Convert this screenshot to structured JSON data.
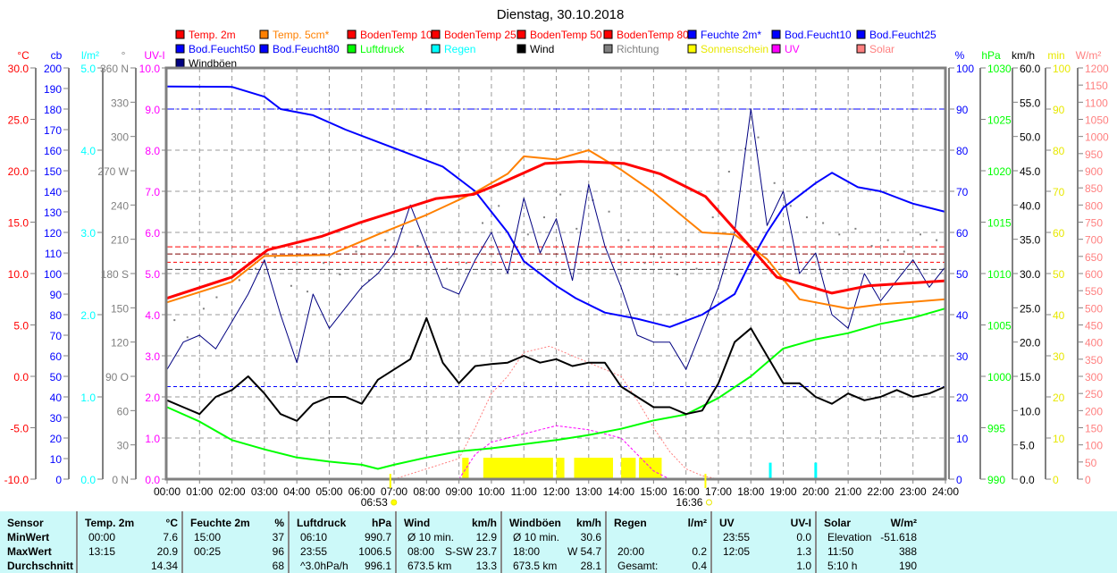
{
  "title": "Dienstag, 30.10.2018",
  "legend": [
    {
      "label": "Temp. 2m",
      "color": "#ff0000"
    },
    {
      "label": "Temp. 5cm*",
      "color": "#ff8000"
    },
    {
      "label": "BodenTemp 10",
      "color": "#ff0000"
    },
    {
      "label": "BodenTemp 25",
      "color": "#ff0000"
    },
    {
      "label": "BodenTemp 50",
      "color": "#ff0000"
    },
    {
      "label": "BodenTemp 80",
      "color": "#ff0000"
    },
    {
      "label": "Feuchte 2m*",
      "color": "#0000ff"
    },
    {
      "label": "Bod.Feucht10",
      "color": "#0000ff"
    },
    {
      "label": "Bod.Feucht25",
      "color": "#0000ff"
    },
    {
      "label": "Bod.Feucht50",
      "color": "#0000ff"
    },
    {
      "label": "Bod.Feucht80",
      "color": "#0000ff"
    },
    {
      "label": "Luftdruck",
      "color": "#00ff00"
    },
    {
      "label": "Regen",
      "color": "#00ffff"
    },
    {
      "label": "Wind",
      "color": "#000000"
    },
    {
      "label": "Richtung",
      "color": "#808080"
    },
    {
      "label": "Sonnenschein",
      "color": "#ffff00"
    },
    {
      "label": "UV",
      "color": "#ff00ff"
    },
    {
      "label": "Solar",
      "color": "#ff8080"
    },
    {
      "label": "Windböen",
      "color": "#000080"
    }
  ],
  "chart_data": {
    "type": "line",
    "title": "Dienstag, 30.10.2018",
    "x_labels": [
      "00:00",
      "01:00",
      "02:00",
      "03:00",
      "04:00",
      "05:00",
      "06:00",
      "07:00",
      "08:00",
      "09:00",
      "10:00",
      "11:00",
      "12:00",
      "13:00",
      "14:00",
      "15:00",
      "16:00",
      "17:00",
      "18:00",
      "19:00",
      "20:00",
      "21:00",
      "22:00",
      "23:00",
      "24:00"
    ],
    "xlim": [
      0,
      24
    ],
    "sunrise": "06:53",
    "sunset": "16:36",
    "sunrise_h": 6.883,
    "sunset_h": 16.6,
    "axes": {
      "temp": {
        "unit": "°C",
        "color": "#ff0000",
        "min": -10,
        "max": 30,
        "labels": [
          "-10.0",
          "-5.0",
          "0.0",
          "5.0",
          "10.0",
          "15.0",
          "20.0",
          "25.0",
          "30.0"
        ]
      },
      "cb": {
        "unit": "cb",
        "color": "#0000ff",
        "min": 0,
        "max": 200,
        "labels": [
          "0",
          "10",
          "20",
          "30",
          "40",
          "50",
          "60",
          "70",
          "80",
          "90",
          "100",
          "110",
          "120",
          "130",
          "140",
          "150",
          "160",
          "170",
          "180",
          "190",
          "200"
        ]
      },
      "rain": {
        "unit": "l/m²",
        "color": "#00ffff",
        "min": 0,
        "max": 5,
        "labels": [
          "0.0",
          "1.0",
          "2.0",
          "3.0",
          "4.0",
          "5.0"
        ]
      },
      "dir": {
        "unit": "°",
        "color": "#808080",
        "min": 0,
        "max": 360,
        "labels": [
          "0 N",
          "30",
          "60",
          "90 O",
          "120",
          "150",
          "180 S",
          "210",
          "240",
          "270 W",
          "300",
          "330",
          "360 N"
        ]
      },
      "uv": {
        "unit": "UV-I",
        "color": "#ff00ff",
        "min": 0,
        "max": 10,
        "labels": [
          "0.0",
          "1.0",
          "2.0",
          "3.0",
          "4.0",
          "5.0",
          "6.0",
          "7.0",
          "8.0",
          "9.0",
          "10.0"
        ]
      },
      "hum": {
        "unit": "%",
        "color": "#0000ff",
        "min": 0,
        "max": 100,
        "labels": [
          "0",
          "10",
          "20",
          "30",
          "40",
          "50",
          "60",
          "70",
          "80",
          "90",
          "100"
        ]
      },
      "press": {
        "unit": "hPa",
        "color": "#00ff00",
        "min": 990,
        "max": 1030,
        "labels": [
          "990",
          "995",
          "1000",
          "1005",
          "1010",
          "1015",
          "1020",
          "1025",
          "1030"
        ]
      },
      "wind": {
        "unit": "km/h",
        "color": "#000000",
        "min": 0,
        "max": 60,
        "labels": [
          "0.0",
          "5.0",
          "10.0",
          "15.0",
          "20.0",
          "25.0",
          "30.0",
          "35.0",
          "40.0",
          "45.0",
          "50.0",
          "55.0",
          "60.0"
        ]
      },
      "sun": {
        "unit": "min",
        "color": "#ffff00",
        "min": 0,
        "max": 100,
        "labels": [
          "0",
          "10",
          "20",
          "30",
          "40",
          "50",
          "60",
          "70",
          "80",
          "90",
          "100"
        ]
      },
      "solar": {
        "unit": "W/m²",
        "color": "#ff8080",
        "min": 0,
        "max": 1200,
        "labels": [
          "0",
          "50",
          "100",
          "150",
          "200",
          "250",
          "300",
          "350",
          "400",
          "450",
          "500",
          "550",
          "600",
          "650",
          "700",
          "750",
          "800",
          "850",
          "900",
          "950",
          "1000",
          "1050",
          "1100",
          "1150",
          "1200"
        ]
      }
    },
    "series": [
      {
        "name": "Solar",
        "axis": "solar",
        "color": "#ff8080",
        "dash": "2,2",
        "width": 1,
        "x": [
          7,
          8,
          9,
          9.5,
          10,
          10.5,
          11,
          11.8,
          12.5,
          13,
          14,
          14.5,
          15,
          15.5,
          16,
          16.5,
          17
        ],
        "y": [
          0,
          30,
          60,
          150,
          250,
          300,
          370,
          388,
          360,
          340,
          300,
          230,
          150,
          80,
          30,
          10,
          0
        ]
      },
      {
        "name": "UV",
        "axis": "uv",
        "color": "#ff00ff",
        "dash": "3,2",
        "width": 1,
        "x": [
          9,
          9.5,
          10,
          11,
          12,
          13,
          14,
          14.5,
          15,
          15.5
        ],
        "y": [
          0,
          0.6,
          0.9,
          1.1,
          1.3,
          1.2,
          1.0,
          0.6,
          0.2,
          0
        ]
      },
      {
        "name": "Luftdruck",
        "axis": "press",
        "color": "#00ff00",
        "width": 2,
        "x": [
          0,
          1,
          2,
          3,
          4,
          5,
          6,
          6.5,
          7,
          8,
          9,
          10,
          11,
          12,
          13,
          14,
          15,
          16,
          17,
          18,
          19,
          20,
          21,
          22,
          23,
          24
        ],
        "y": [
          997.0,
          995.6,
          993.8,
          992.9,
          992.1,
          991.7,
          991.4,
          991.0,
          991.4,
          992.1,
          992.7,
          993,
          993.4,
          993.8,
          994.3,
          994.9,
          995.7,
          996.3,
          997.9,
          1000,
          1002.7,
          1003.6,
          1004.2,
          1005.1,
          1005.7,
          1006.6
        ]
      },
      {
        "name": "Feuchte 2m*",
        "axis": "hum",
        "color": "#0000ff",
        "width": 2,
        "x": [
          0,
          2,
          3,
          3.5,
          4.5,
          5.5,
          6.5,
          7.5,
          8.5,
          9.5,
          10.5,
          11,
          12,
          12.6,
          13.5,
          14.5,
          15,
          15.5,
          16.5,
          17.5,
          18,
          18.5,
          19,
          20,
          20.5,
          21.3,
          22,
          23,
          24
        ],
        "y": [
          95.5,
          95.4,
          93,
          90,
          88.5,
          85,
          82,
          79,
          76,
          70,
          60,
          53,
          47,
          44,
          40.5,
          39,
          38,
          37,
          40,
          45,
          53,
          60,
          66,
          72,
          74.5,
          71,
          70,
          67,
          65
        ]
      },
      {
        "name": "Windböen",
        "axis": "wind",
        "color": "#000080",
        "width": 1,
        "x": [
          0,
          0.5,
          1,
          1.5,
          2,
          2.5,
          3,
          3.5,
          4,
          4.5,
          5,
          5.5,
          6,
          6.5,
          7,
          7.5,
          8,
          8.5,
          9,
          9.5,
          10,
          10.5,
          11,
          11.5,
          12,
          12.5,
          13,
          13.5,
          14,
          14.5,
          15,
          15.5,
          16,
          16.5,
          17,
          17.5,
          18,
          18.5,
          19,
          19.5,
          20,
          20.5,
          21,
          21.5,
          22,
          22.5,
          23,
          23.5,
          24
        ],
        "y": [
          16,
          20,
          21,
          19,
          23,
          27,
          32,
          24,
          17,
          27,
          22,
          25,
          28,
          30,
          33,
          40,
          34,
          28,
          27,
          32,
          36,
          30,
          41,
          33,
          38,
          29,
          43,
          34,
          28,
          21,
          20,
          20,
          16,
          22,
          28,
          36,
          54,
          37,
          42,
          30,
          33,
          24,
          22,
          30,
          26,
          29,
          32,
          28,
          31
        ]
      },
      {
        "name": "Wind",
        "axis": "wind",
        "color": "#000000",
        "width": 2,
        "x": [
          0,
          0.5,
          1,
          1.5,
          2,
          2.5,
          3,
          3.5,
          4,
          4.5,
          5,
          5.5,
          6,
          6.5,
          7,
          7.5,
          8,
          8.5,
          9,
          9.5,
          10,
          10.5,
          11,
          11.5,
          12,
          12.5,
          13,
          13.5,
          14,
          14.5,
          15,
          15.5,
          16,
          16.5,
          17,
          17.5,
          18,
          18.5,
          19,
          19.5,
          20,
          20.5,
          21,
          21.5,
          22,
          22.5,
          23,
          23.5,
          24
        ],
        "y": [
          11.5,
          10.5,
          9.5,
          12,
          13,
          15,
          12.5,
          9.5,
          8.5,
          11,
          12,
          12,
          11,
          14.5,
          16,
          17.5,
          23.5,
          17,
          14,
          16.5,
          16.8,
          17,
          18,
          17,
          17.5,
          16.5,
          17,
          17,
          13.5,
          12,
          10.5,
          10.5,
          9.5,
          10,
          14,
          20,
          22,
          18,
          14,
          14,
          12,
          11,
          12.5,
          11.5,
          12,
          13,
          12,
          12.5,
          13.5
        ]
      },
      {
        "name": "Temp. 5cm*",
        "axis": "temp",
        "color": "#ff8000",
        "width": 2,
        "x": [
          0,
          2,
          3,
          5,
          6.5,
          8,
          9.5,
          10.5,
          11,
          12,
          13,
          14,
          15,
          16,
          16.5,
          17.5,
          18.5,
          19.5,
          21,
          22,
          24
        ],
        "y": [
          7.2,
          9.2,
          11.7,
          11.8,
          13.8,
          15.7,
          17.9,
          19.7,
          21.4,
          21.1,
          22.0,
          20.1,
          17.9,
          15.3,
          14.0,
          13.8,
          11.4,
          7.5,
          6.6,
          7.0,
          7.5
        ]
      },
      {
        "name": "Temp. 2m",
        "axis": "temp",
        "color": "#ff0000",
        "width": 3,
        "x": [
          0,
          2,
          3.1,
          4.75,
          5.9,
          7,
          8.3,
          9.45,
          10.3,
          11.65,
          12.75,
          14.1,
          15.2,
          16.6,
          17.7,
          18.8,
          20.5,
          21.6,
          24
        ],
        "y": [
          7.6,
          9.65,
          12.3,
          13.6,
          14.9,
          16.0,
          17.3,
          17.7,
          18.8,
          20.7,
          20.9,
          20.7,
          19.7,
          17.5,
          13.6,
          9.65,
          8.1,
          8.8,
          9.3
        ]
      }
    ],
    "constant_lines": [
      {
        "name": "Bod.Feucht10",
        "axis": "hum",
        "value": 90,
        "color": "#0000ff",
        "dash": "8,3,2,3"
      },
      {
        "name": "Bod.Feucht25",
        "axis": "hum",
        "value": 100,
        "color": "#0000ff",
        "dash": ""
      },
      {
        "name": "BodenTemp 10",
        "axis": "temp",
        "value": 12.6,
        "color": "#ff0000",
        "dash": "6,3"
      },
      {
        "name": "BodenTemp 25",
        "axis": "temp",
        "value": 11.9,
        "color": "#800000",
        "dash": "6,3"
      },
      {
        "name": "BodenTemp 50",
        "axis": "temp",
        "value": 11.1,
        "color": "#ff0000",
        "dash": "4,3"
      },
      {
        "name": "BodenTemp 80",
        "axis": "temp",
        "value": 10.4,
        "color": "#404040",
        "dash": "6,3"
      },
      {
        "name": "Bod.Feucht50",
        "axis": "hum",
        "value": 22.5,
        "color": "#0000ff",
        "dash": "4,3"
      }
    ],
    "richtung": {
      "axis": "dir",
      "color": "#808080",
      "x": [
        0.2,
        0.6,
        1.1,
        1.5,
        2.2,
        2.7,
        3.3,
        3.8,
        4.3,
        4.8,
        5.3,
        5.8,
        6.2,
        6.7,
        7.2,
        7.7,
        8.1,
        8.6,
        9.2,
        9.7,
        10.2,
        10.6,
        11.1,
        11.6,
        12.1,
        12.6,
        13.1,
        13.6,
        14.2,
        14.7,
        15.2,
        15.7,
        16.3,
        16.8,
        17.3,
        17.8,
        18.2,
        18.7,
        19.2,
        19.7,
        20.2,
        20.7,
        21.2,
        21.7,
        22.2,
        22.7,
        23.2,
        23.7
      ],
      "y": [
        140,
        125,
        150,
        160,
        175,
        185,
        195,
        170,
        165,
        190,
        180,
        200,
        175,
        210,
        220,
        205,
        195,
        185,
        190,
        225,
        240,
        200,
        215,
        230,
        250,
        220,
        245,
        235,
        210,
        190,
        195,
        180,
        185,
        230,
        270,
        290,
        300,
        260,
        240,
        230,
        225,
        215,
        220,
        205,
        210,
        200,
        215,
        210
      ]
    },
    "sunshine": {
      "axis": "sun",
      "color": "#ffff00",
      "bars": [
        [
          9.1,
          9.3,
          5.2
        ],
        [
          9.75,
          11.9,
          5.2
        ],
        [
          12.0,
          12.25,
          5.2
        ],
        [
          12.55,
          13.75,
          5.2
        ],
        [
          14.0,
          14.45,
          5.2
        ],
        [
          14.55,
          15.25,
          5.2
        ]
      ]
    },
    "rain": {
      "axis": "rain",
      "color": "#00ffff",
      "bars": [
        [
          18.6,
          0.2
        ],
        [
          20.0,
          0.2
        ]
      ]
    }
  },
  "table": {
    "row_labels": [
      "Sensor",
      "MinWert",
      "MaxWert",
      "Durchschnitt"
    ],
    "columns": [
      {
        "name": "Temp. 2m",
        "unit": "°C",
        "rows": [
          [
            "00:00",
            "7.6"
          ],
          [
            "13:15",
            "20.9"
          ],
          [
            "",
            "14.34"
          ]
        ]
      },
      {
        "name": "Feuchte 2m",
        "unit": "%",
        "rows": [
          [
            "15:00",
            "37"
          ],
          [
            "00:25",
            "96"
          ],
          [
            "",
            "68"
          ]
        ]
      },
      {
        "name": "Luftdruck",
        "unit": "hPa",
        "rows": [
          [
            "06:10",
            "990.7"
          ],
          [
            "23:55",
            "1006.5"
          ],
          [
            "^3.0hPa/h",
            "996.1"
          ]
        ]
      },
      {
        "name": "Wind",
        "unit": "km/h",
        "rows": [
          [
            "Ø 10 min.",
            "12.9"
          ],
          [
            "08:00",
            "S-SW 23.7"
          ],
          [
            "673.5 km",
            "13.3"
          ]
        ]
      },
      {
        "name": "Windböen",
        "unit": "km/h",
        "rows": [
          [
            "Ø 10 min.",
            "30.6"
          ],
          [
            "18:00",
            "W 54.7"
          ],
          [
            "673.5 km",
            "28.1"
          ]
        ]
      },
      {
        "name": "Regen",
        "unit": "l/m²",
        "rows": [
          [
            "",
            ""
          ],
          [
            "20:00",
            "0.2"
          ],
          [
            "Gesamt:",
            "0.4"
          ]
        ]
      },
      {
        "name": "UV",
        "unit": "UV-I",
        "rows": [
          [
            "23:55",
            "0.0"
          ],
          [
            "12:05",
            "1.3"
          ],
          [
            "",
            "1.0"
          ]
        ]
      },
      {
        "name": "Solar",
        "unit": "W/m²",
        "rows": [
          [
            "Elevation",
            "-51.618"
          ],
          [
            "11:50",
            "388"
          ],
          [
            "5:10 h",
            "190"
          ]
        ]
      }
    ]
  }
}
